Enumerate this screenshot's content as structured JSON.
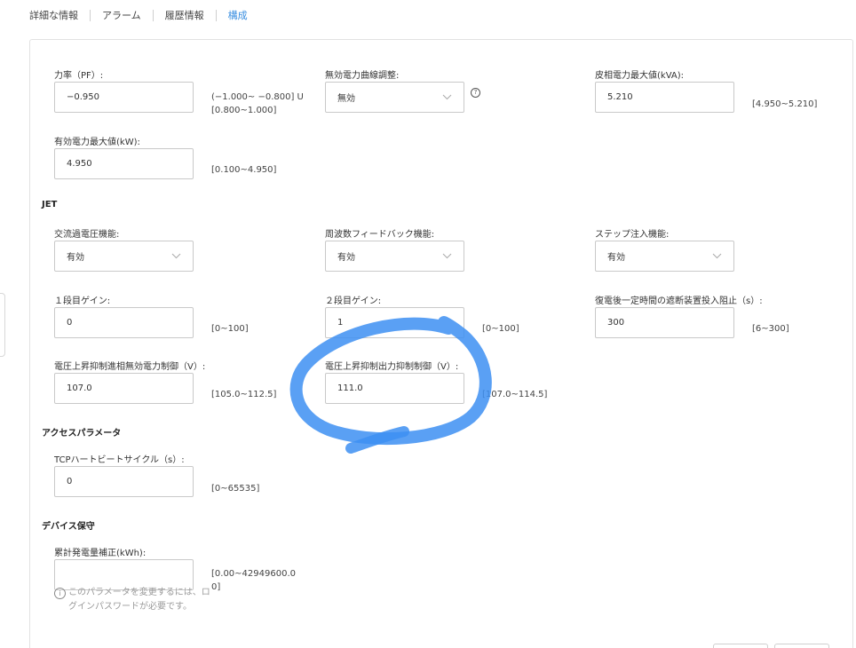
{
  "tabs": [
    {
      "label": "詳細な情報"
    },
    {
      "label": "アラーム"
    },
    {
      "label": "履歴情報"
    },
    {
      "label": "構成"
    }
  ],
  "fields": {
    "pf": {
      "label": "力率（PF）:",
      "value": "−0.950",
      "range_line1": "(−1.000~ −0.800] U",
      "range_line2": "[0.800~1.000]"
    },
    "reactive_curve": {
      "label": "無効電力曲線調整:",
      "value": "無効",
      "help": "?"
    },
    "apparent_max": {
      "label": "皮相電力最大値(kVA):",
      "value": "5.210",
      "range": "[4.950~5.210]"
    },
    "active_max": {
      "label": "有効電力最大値(kW):",
      "value": "4.950",
      "range": "[0.100~4.950]"
    },
    "ac_overvoltage": {
      "label": "交流過電圧機能:",
      "value": "有効"
    },
    "freq_feedback": {
      "label": "周波数フィードバック機能:",
      "value": "有効"
    },
    "step_injection": {
      "label": "ステップ注入機能:",
      "value": "有効"
    },
    "gain1": {
      "label": "１段目ゲイン:",
      "value": "0",
      "range": "[0~100]"
    },
    "gain2": {
      "label": "２段目ゲイン:",
      "value": "1",
      "range": "[0~100]"
    },
    "reclose_block": {
      "label": "復電後一定時間の遮断装置投入阻止（s）:",
      "value": "300",
      "range": "[6~300]"
    },
    "v_rise_reactive": {
      "label": "電圧上昇抑制進相無効電力制御（V）:",
      "value": "107.0",
      "range": "[105.0~112.5]"
    },
    "v_rise_output": {
      "label": "電圧上昇抑制出力抑制制御（V）:",
      "value": "111.0",
      "range": "[107.0~114.5]"
    },
    "tcp_heartbeat": {
      "label": "TCPハートビートサイクル（s）:",
      "value": "0",
      "range": "[0~65535]"
    },
    "energy_correction": {
      "label": "累計発電量補正(kWh):",
      "value": "",
      "range_line1": "[0.00~42949600.0",
      "range_line2": "0]",
      "info": "i",
      "note": "このパラメータを変更するには、ログインパスワードが必要です。"
    }
  },
  "sections": {
    "jet": "JET",
    "access": "アクセスパラメータ",
    "maintenance": "デバイス保守"
  },
  "colors": {
    "accent": "#3b8fe0",
    "annotation": "#3d8ff2"
  },
  "icons": {
    "dropdown": "chevron-down-icon",
    "help": "question-circle-icon",
    "info": "info-circle-icon"
  }
}
